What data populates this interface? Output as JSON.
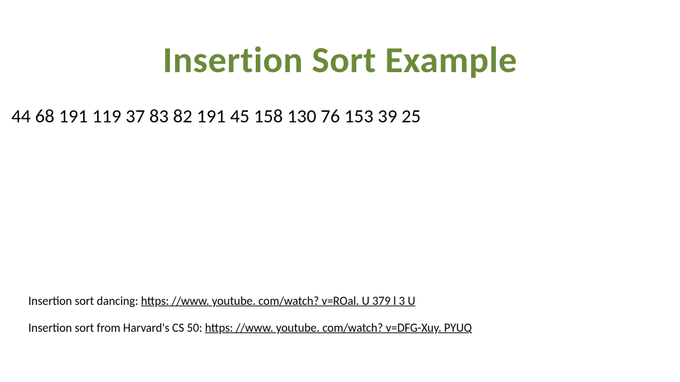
{
  "title": "Insertion Sort Example",
  "numbers": [
    44,
    68,
    191,
    119,
    37,
    83,
    82,
    191,
    45,
    158,
    130,
    76,
    153,
    39,
    25
  ],
  "footer": {
    "line1": {
      "label": "Insertion sort dancing: ",
      "link_text": "https: //www. youtube. com/watch? v=ROal. U 379 l 3 U"
    },
    "line2": {
      "label": "Insertion sort from Harvard's CS 50: ",
      "link_text": "https: //www. youtube. com/watch? v=DFG-Xuy. PYUQ"
    }
  }
}
